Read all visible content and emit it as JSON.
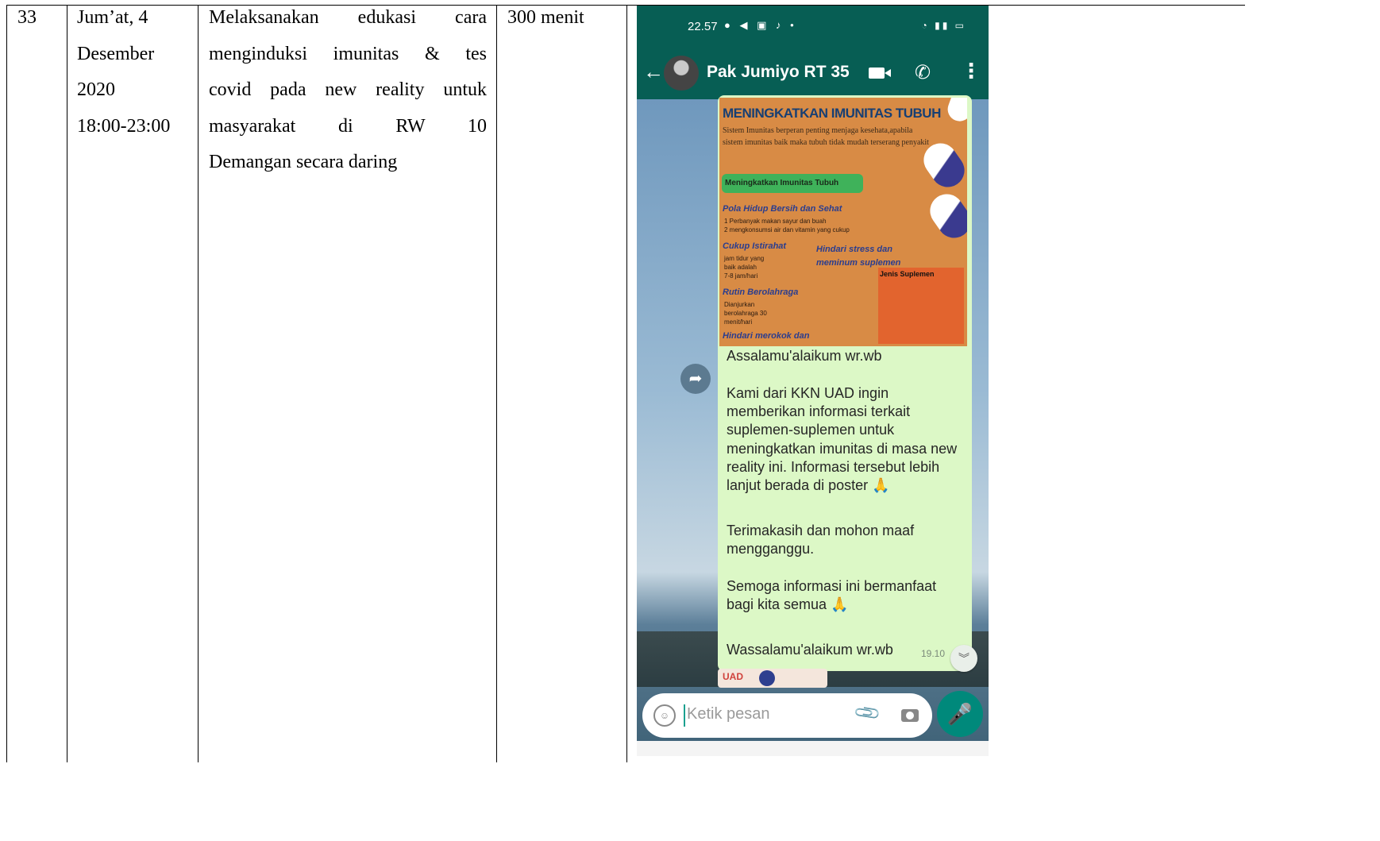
{
  "table_row": {
    "number": "33",
    "date_lines": [
      "Jum’at, 4",
      "Desember",
      "2020",
      "18:00-23:00"
    ],
    "activity_lines": [
      "Melaksanakan edukasi cara",
      "menginduksi imunitas & tes",
      "covid pada new reality untuk",
      "masyarakat di RW 10",
      "Demangan secara daring"
    ],
    "duration": "300 menit"
  },
  "phone": {
    "status_time": "22.57",
    "contact_name": "Pak Jumiyo RT 35",
    "poster": {
      "title": "MENINGKATKAN IMUNITAS TUBUH",
      "intro": "Sistem Imunitas berperan penting menjaga kesehata,apabila sistem imunitas baik maka tubuh tidak mudah terserang penyakit",
      "badge": "Meningkatkan Imunitas Tubuh",
      "section1_title": "Pola Hidup Bersih dan Sehat",
      "section1_lines": [
        "1 Perbanyak makan sayur dan buah",
        "2 mengkonsumsi air dan vitamin yang cukup"
      ],
      "section2_title": "Cukup Istirahat",
      "section2_lines": [
        "jam tidur yang",
        "baik adalah",
        "7-8 jam/hari"
      ],
      "section3_title": "Rutin Berolahraga",
      "section3_lines": [
        "Dianjurkan",
        "berolahraga 30",
        "menit/hari"
      ],
      "section4_title": "Hindari stress dan",
      "section4_title2": "meminum suplemen",
      "section5_title": "Hindari merokok dan",
      "supplement_label": "Jenis Suplemen"
    },
    "message_lines": [
      "Assalamu'alaikum wr.wb",
      "Kami dari KKN UAD ingin memberikan informasi terkait suplemen-suplemen untuk meningkatkan imunitas di masa new reality ini. Informasi tersebut lebih lanjut berada di poster 🙏",
      "Terimakasih dan mohon maaf mengganggu.",
      "Semoga informasi ini bermanfaat bagi kita semua 🙏",
      "Wassalamu'alaikum wr.wb"
    ],
    "message_time": "19.10",
    "next_bubble_label": "UAD",
    "input_placeholder": "Ketik pesan"
  },
  "icons": {
    "back": "arrow-left-icon",
    "video": "video-call-icon",
    "call": "phone-icon",
    "menu": "more-vert-icon",
    "forward": "forward-icon",
    "emoji": "emoji-icon",
    "attach": "paperclip-icon",
    "camera": "camera-icon",
    "mic": "microphone-icon",
    "scroll": "chevron-double-down-icon"
  },
  "colors": {
    "whatsapp_header": "#075e54",
    "outgoing_bubble": "#dcf8c6",
    "mic_button": "#00897b",
    "poster_bg": "#d88b45"
  }
}
